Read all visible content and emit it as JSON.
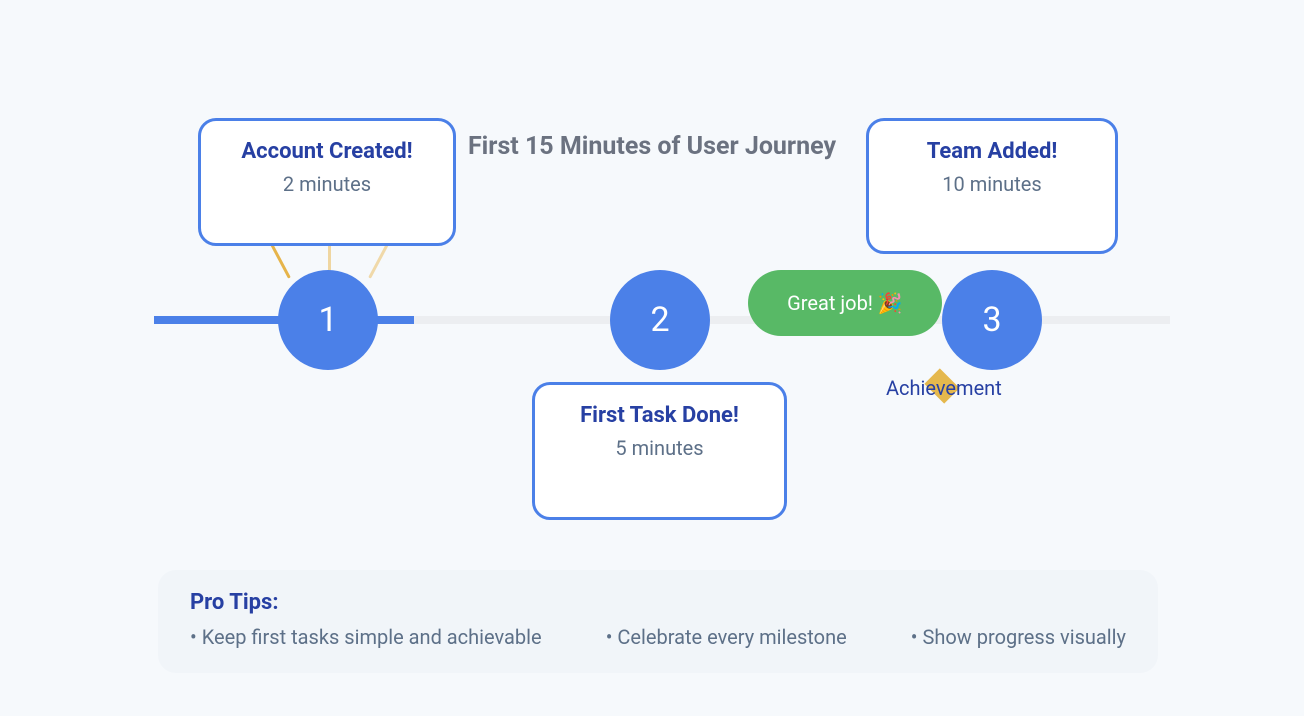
{
  "title": "First 15 Minutes of User Journey",
  "milestones": [
    {
      "num": "1",
      "heading": "Account Created!",
      "time": "2 minutes"
    },
    {
      "num": "2",
      "heading": "First Task Done!",
      "time": "5 minutes"
    },
    {
      "num": "3",
      "heading": "Team Added!",
      "time": "10 minutes"
    }
  ],
  "achievement": {
    "pill": "Great job! 🎉",
    "label": "Achievement"
  },
  "tips": {
    "heading": "Pro Tips:",
    "items": [
      "• Keep first tasks simple and achievable",
      "• Celebrate every milestone",
      "• Show progress visually"
    ]
  }
}
